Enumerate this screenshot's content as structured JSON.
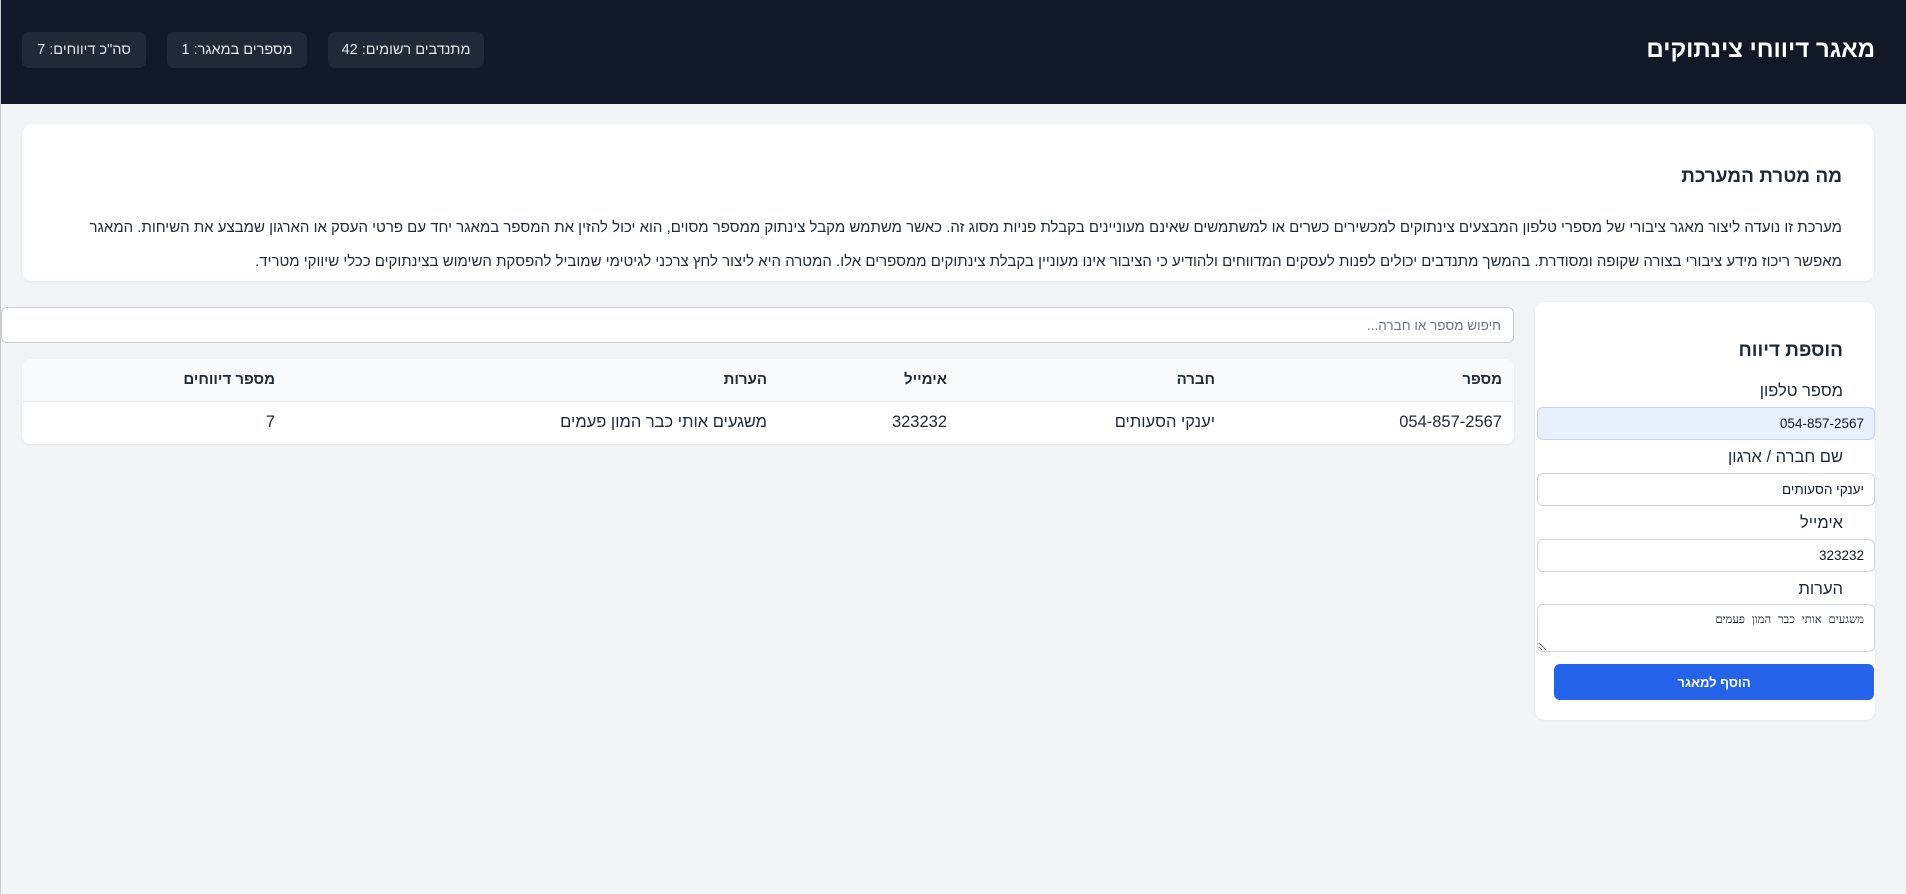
{
  "header": {
    "title": "מאגר דיווחי צינתוקים",
    "stats": [
      {
        "label": "מתנדבים רשומים: 42"
      },
      {
        "label": "מספרים במאגר: 1"
      },
      {
        "label": "סה\"כ דיווחים: 7"
      }
    ]
  },
  "about": {
    "title": "מה מטרת המערכת",
    "text": "מערכת זו נועדה ליצור מאגר ציבורי של מספרי טלפון המבצעים צינתוקים למכשירים כשרים או למשתמשים שאינם מעוניינים בקבלת פניות מסוג זה. כאשר משתמש מקבל צינתוק ממספר מסוים, הוא יכול להזין את המספר במאגר יחד עם פרטי העסק או הארגון שמבצע את השיחות. המאגר מאפשר ריכוז מידע ציבורי בצורה שקופה ומסודרת. בהמשך מתנדבים יכולים לפנות לעסקים המדווחים ולהודיע כי הציבור אינו מעוניין בקבלת צינתוקים ממספרים אלו. המטרה היא ליצור לחץ צרכני לגיטימי שמוביל להפסקת השימוש בצינתוקים ככלי שיווקי מטריד."
  },
  "form": {
    "title": "הוספת דיווח",
    "phone_label": "מספר טלפון",
    "phone_value": "054-857-2567",
    "company_label": "שם חברה / ארגון",
    "company_value": "יענקי הסעותים",
    "email_label": "אימייל",
    "email_value": "323232",
    "notes_label": "הערות",
    "notes_value": "משגעים אותי כבר המון פעמים",
    "submit_label": "הוסף למאגר"
  },
  "search": {
    "placeholder": "חיפוש מספר או חברה..."
  },
  "table": {
    "headers": {
      "number": "מספר",
      "company": "חברה",
      "email": "אימייל",
      "notes": "הערות",
      "reports": "מספר דיווחים"
    },
    "rows": [
      {
        "number": "054-857-2567",
        "company": "יענקי הסעותים",
        "email": "323232",
        "notes": "משגעים אותי כבר המון פעמים",
        "reports": "7"
      }
    ]
  },
  "colors": {
    "header_bg": "#111827",
    "pill_bg": "#1f2937",
    "accent": "#2563eb",
    "page_bg": "#f3f4f6"
  }
}
